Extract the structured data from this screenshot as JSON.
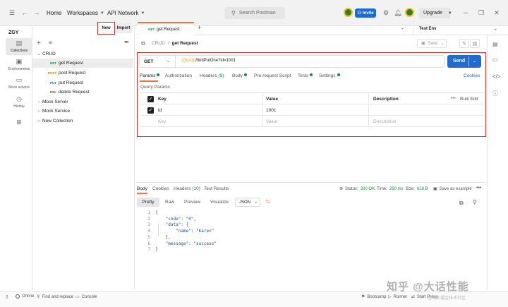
{
  "titlebar": {
    "home": "Home",
    "workspaces": "Workspaces",
    "api_network": "API Network",
    "search_placeholder": "Search Postman",
    "invite": "Invite",
    "upgrade": "Upgrade"
  },
  "workspace": {
    "name": "ZGY",
    "new_label": "New",
    "import_label": "Import"
  },
  "rail": {
    "collections": "Collections",
    "environments": "Environments",
    "mock_servers": "Mock servers",
    "history": "History"
  },
  "tree": {
    "crud": "CRUD",
    "requests": [
      {
        "method": "GET",
        "name": "get Request"
      },
      {
        "method": "POST",
        "name": "post Request"
      },
      {
        "method": "PUT",
        "name": "put Request"
      },
      {
        "method": "DEL",
        "name": "delete Request"
      }
    ],
    "mock_server": "Mock Server",
    "mock_service": "Mock Service",
    "new_collection": "New Collection"
  },
  "tabs": {
    "active_method": "GET",
    "active_name": "get Request",
    "environment": "Test Env"
  },
  "breadcrumb": {
    "collection": "CRUD",
    "separator": "/",
    "request": "get Request"
  },
  "save_label": "Save",
  "request": {
    "method": "GET",
    "url_var": "{{host}}",
    "url_path": "/findPutOne?id=1001",
    "send": "Send",
    "tabs": {
      "params": "Params",
      "authorization": "Authorization",
      "headers": "Headers",
      "headers_count": "(9)",
      "body": "Body",
      "prerequest": "Pre-request Script",
      "tests": "Tests",
      "settings": "Settings"
    },
    "cookies": "Cookies",
    "query_params_title": "Query Params",
    "table": {
      "col_key": "Key",
      "col_value": "Value",
      "col_description": "Description",
      "bulk_edit": "Bulk Edit",
      "row_key": "id",
      "row_value": "1001",
      "ph_key": "Key",
      "ph_value": "Value",
      "ph_description": "Description"
    }
  },
  "response": {
    "tabs": {
      "body": "Body",
      "cookies": "Cookies",
      "headers": "Headers",
      "headers_count": "(10)",
      "test_results": "Test Results"
    },
    "status_label": "Status:",
    "status_value": "200 OK",
    "time_label": "Time:",
    "time_value": "250 ms",
    "size_label": "Size:",
    "size_value": "618 B",
    "save_example": "Save as example",
    "format": {
      "pretty": "Pretty",
      "raw": "Raw",
      "preview": "Preview",
      "visualize": "Visualize",
      "json": "JSON"
    },
    "lines": [
      {
        "n": "1",
        "text": "{"
      },
      {
        "n": "2",
        "text": "    \"code\": \"0\","
      },
      {
        "n": "3",
        "text": "    \"data\": {"
      },
      {
        "n": "4",
        "text": "        \"name\": \"Karen\""
      },
      {
        "n": "5",
        "text": "    },"
      },
      {
        "n": "6",
        "text": "    \"message\": \"success\""
      },
      {
        "n": "7",
        "text": "}"
      }
    ]
  },
  "statusbar": {
    "online": "Online",
    "find_replace": "Find and replace",
    "console": "Console",
    "bootcamp": "Bootcamp",
    "runner": "Runner",
    "start_proxy": "Start Proxy"
  },
  "watermark": {
    "main": "知乎 @大话性能",
    "sub": "@稀土掘金技术社区"
  }
}
